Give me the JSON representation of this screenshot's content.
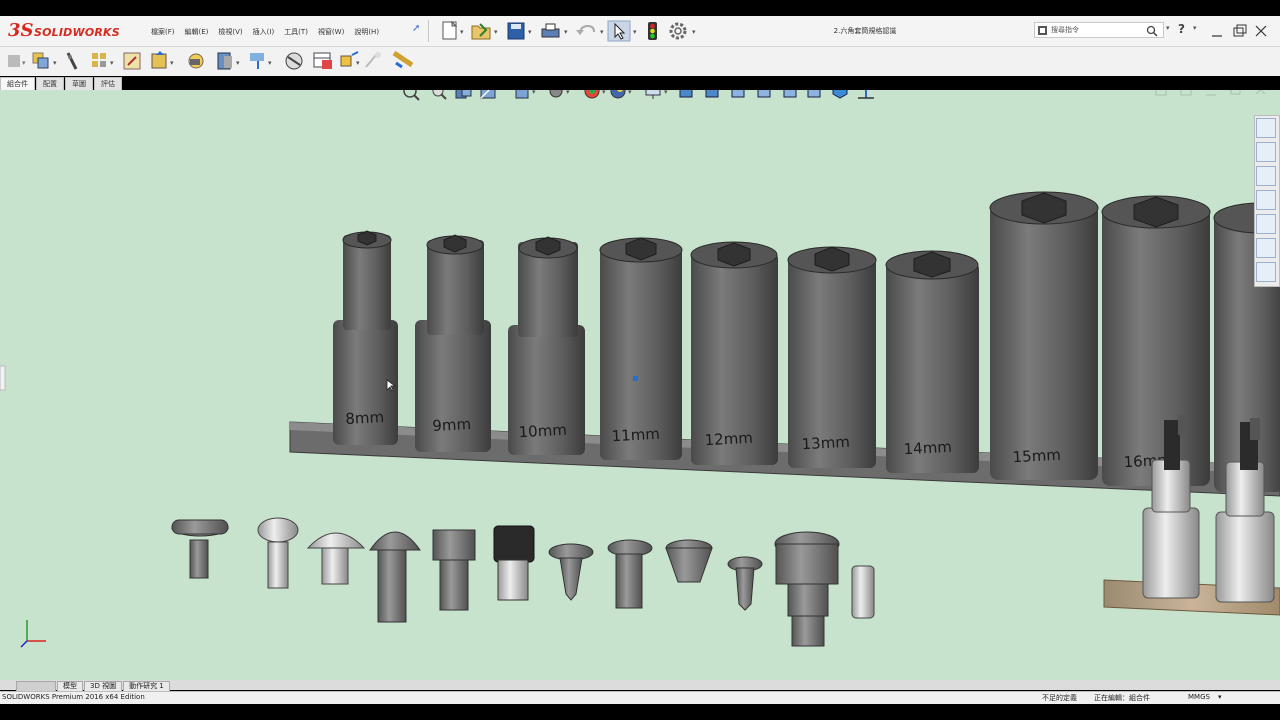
{
  "app": {
    "brand_ds": "3S",
    "brand_name": "SOLIDWORKS"
  },
  "menu": [
    "檔案(F)",
    "編輯(E)",
    "檢視(V)",
    "插入(I)",
    "工具(T)",
    "視窗(W)",
    "說明(H)"
  ],
  "document_title": "2.六角套筒規格認識",
  "search": {
    "placeholder": "搜尋指令"
  },
  "help_label": "?",
  "tabs": [
    {
      "label": "組合件",
      "active": true
    },
    {
      "label": "配置",
      "active": false
    },
    {
      "label": "草圖",
      "active": false
    },
    {
      "label": "評估",
      "active": false
    }
  ],
  "bottom_tabs": [
    "模型",
    "3D 視圖",
    "動作研究 1"
  ],
  "sockets": [
    "8mm",
    "9mm",
    "10mm",
    "11mm",
    "12mm",
    "13mm",
    "14mm",
    "15mm",
    "16mm"
  ],
  "status": {
    "left": "SOLIDWORKS Premium 2016 x64 Edition",
    "underdefined": "不足的定義",
    "editing": "正在編輯：組合件",
    "units": "MMGS",
    "units_caret": "▾"
  },
  "colors": {
    "viewport_bg": "#c8e3cd",
    "brand": "#d52a1e",
    "socket": "#666666"
  }
}
